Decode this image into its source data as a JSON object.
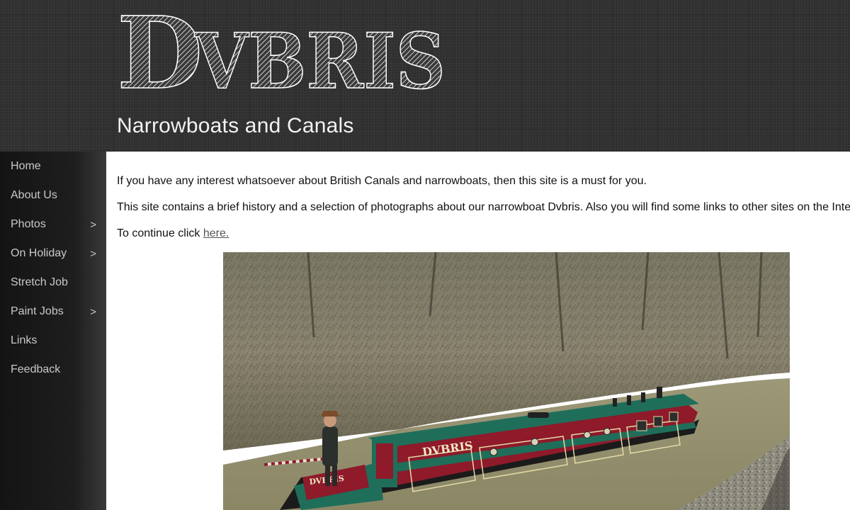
{
  "site": {
    "logo_text": "Dvbris",
    "logo_initial": "D",
    "logo_rest": "VBRIS",
    "tagline": "Narrowboats and Canals"
  },
  "sidebar": {
    "items": [
      {
        "label": "Home",
        "has_submenu": false
      },
      {
        "label": "About Us",
        "has_submenu": false
      },
      {
        "label": "Photos",
        "has_submenu": true,
        "arrow": ">"
      },
      {
        "label": "On Holiday",
        "has_submenu": true,
        "arrow": ">"
      },
      {
        "label": "Stretch Job",
        "has_submenu": false
      },
      {
        "label": "Paint Jobs",
        "has_submenu": true,
        "arrow": ">"
      },
      {
        "label": "Links",
        "has_submenu": false
      },
      {
        "label": "Feedback",
        "has_submenu": false
      }
    ]
  },
  "main": {
    "intro": "If you have any interest whatsoever about British Canals and narrowboats, then this site is a must for you.",
    "description": "This site contains a brief history and a selection of photographs about our narrowboat Dvbris. Also you will find some links to other sites on the Internet.",
    "continue_prefix": "To continue click ",
    "continue_link": "here.",
    "boat_name_on_hull": "DVBRIS",
    "boat_name_on_stern": "DVBRIS"
  },
  "colors": {
    "header_bg": "#2f2f2f",
    "sidebar_bg": "#1a1a1a",
    "nav_text": "#c9c9c9",
    "boat_hull_red": "#8e1a2a",
    "boat_green": "#1f6e5a"
  }
}
